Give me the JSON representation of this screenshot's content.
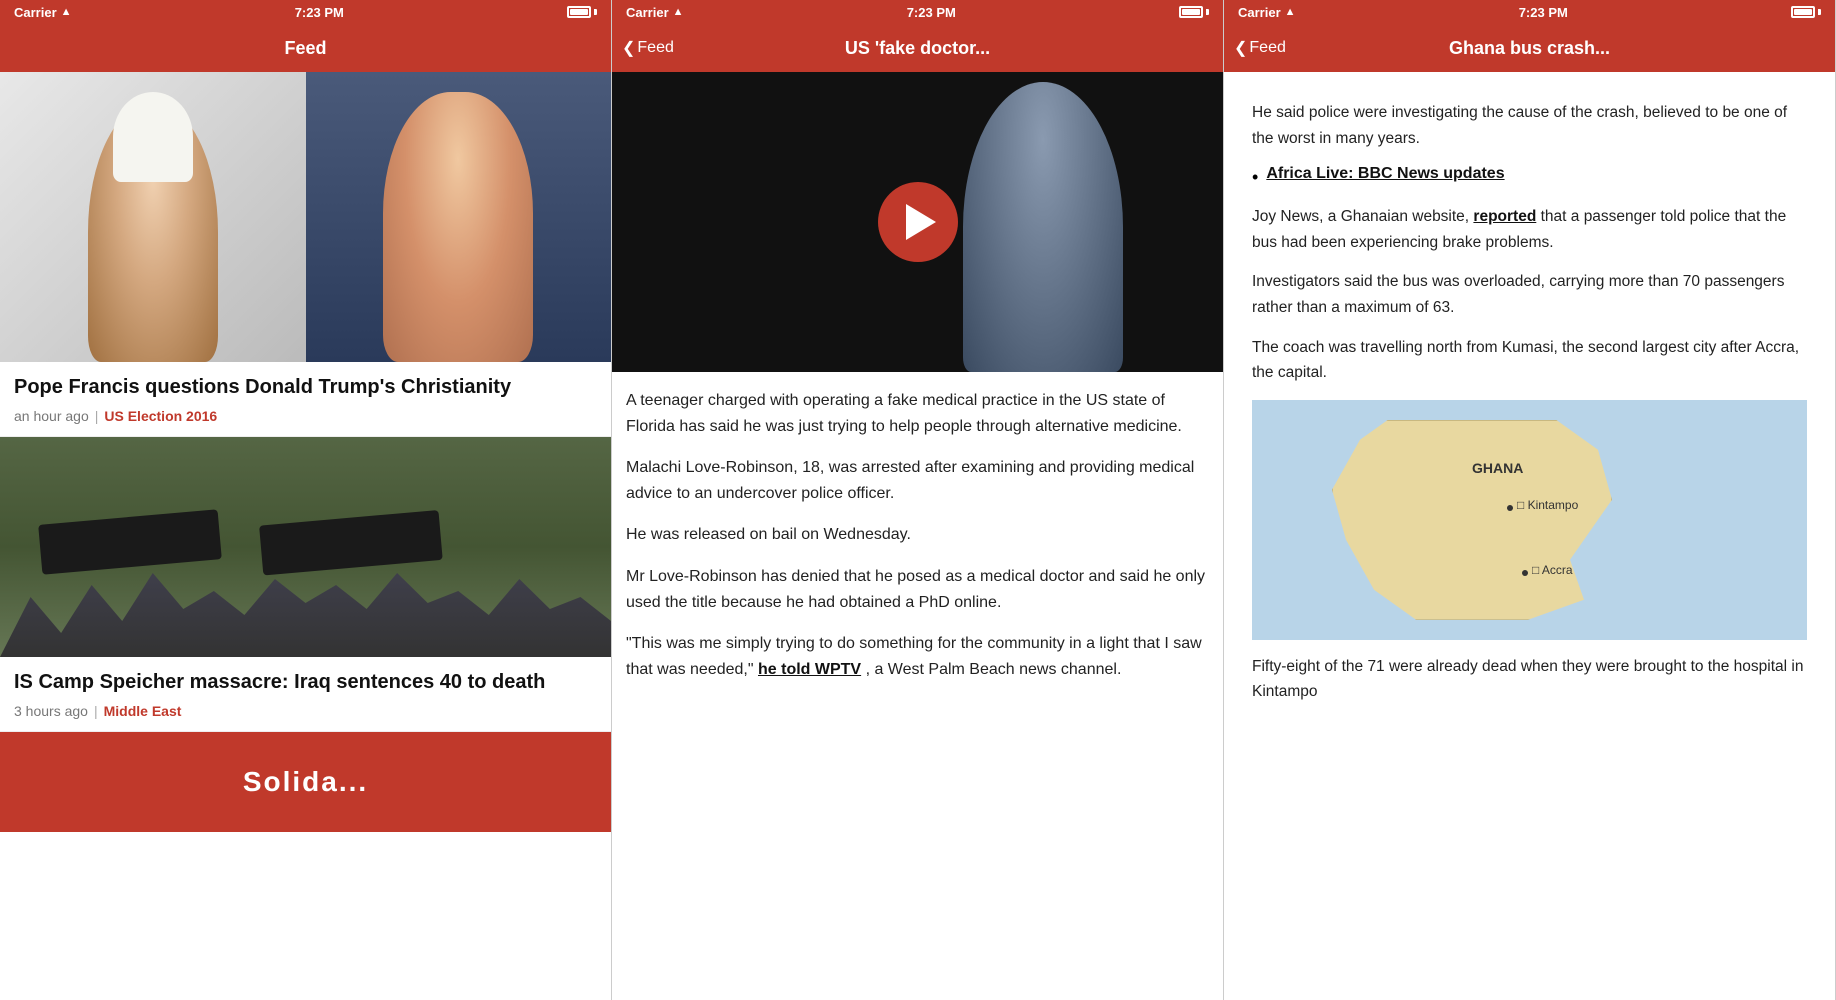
{
  "panel1": {
    "statusBar": {
      "carrier": "Carrier",
      "time": "7:23 PM"
    },
    "navTitle": "Feed",
    "article1": {
      "headline": "Pope Francis questions Donald Trump's Christianity",
      "timeAgo": "an hour ago",
      "category": "US Election 2016"
    },
    "article2": {
      "headline": "IS Camp Speicher massacre: Iraq sentences 40 to death",
      "timeAgo": "3 hours ago",
      "category": "Middle East"
    },
    "solidarity": "Solida..."
  },
  "panel2": {
    "statusBar": {
      "carrier": "Carrier",
      "time": "7:23 PM"
    },
    "navBack": "Feed",
    "navTitle": "US 'fake doctor...",
    "body": [
      "A teenager charged with operating a fake medical practice in the US state of Florida has said he was just trying to help people through alternative medicine.",
      "Malachi Love-Robinson, 18, was arrested after examining and providing medical advice to an undercover police officer.",
      "He was released on bail on Wednesday.",
      "Mr Love-Robinson has denied that he posed as a medical doctor and said he only used the title because he had obtained a PhD online.",
      "\"This was me simply trying to do something for the community in a light that I saw that was needed,\"",
      "a West Palm Beach news channel."
    ],
    "linkText": "he told WPTV",
    "linkSuffix": ", a West Palm Beach news channel."
  },
  "panel3": {
    "statusBar": {
      "carrier": "Carrier",
      "time": "7:23 PM"
    },
    "navBack": "Feed",
    "navTitle": "Ghana bus crash...",
    "paragraphs": [
      "He said police were investigating the cause of the crash, believed to be one of the worst in many years.",
      "Joy News, a Ghanaian website, reported that a passenger told police that the bus had been experiencing brake problems.",
      "Investigators said the bus was overloaded, carrying more than 70 passengers rather than a maximum of 63.",
      "The coach was travelling north from Kumasi, the second largest city after Accra, the capital.",
      "Fifty-eight of the 71 were already dead when they were brought to the hospital in Kintampo"
    ],
    "bulletLink": "Africa Live: BBC News updates",
    "reportedLink": "reported",
    "mapLabels": {
      "ghana": "GHANA",
      "kintampo": "□ Kintampo",
      "accra": "□ Accra"
    }
  }
}
